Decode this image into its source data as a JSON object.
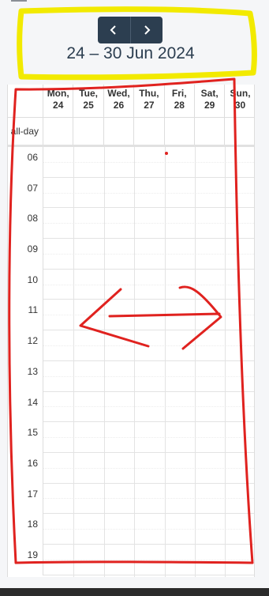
{
  "toolbar": {
    "prev_icon": "chevron-left-icon",
    "next_icon": "chevron-right-icon",
    "title": "24 – 30 Jun 2024"
  },
  "calendar": {
    "days": [
      {
        "label": "Mon,\n24"
      },
      {
        "label": "Tue,\n25"
      },
      {
        "label": "Wed,\n26"
      },
      {
        "label": "Thu,\n27"
      },
      {
        "label": "Fri,\n28"
      },
      {
        "label": "Sat,\n29"
      },
      {
        "label": "Sun,\n30"
      }
    ],
    "allday_label": "all-day",
    "hours": [
      "06",
      "07",
      "08",
      "09",
      "10",
      "11",
      "12",
      "13",
      "14",
      "15",
      "16",
      "17",
      "18",
      "19"
    ]
  },
  "colors": {
    "accent": "#2c3e50",
    "highlight_yellow": "#f2ea00",
    "annotation_red": "#e0221f"
  }
}
